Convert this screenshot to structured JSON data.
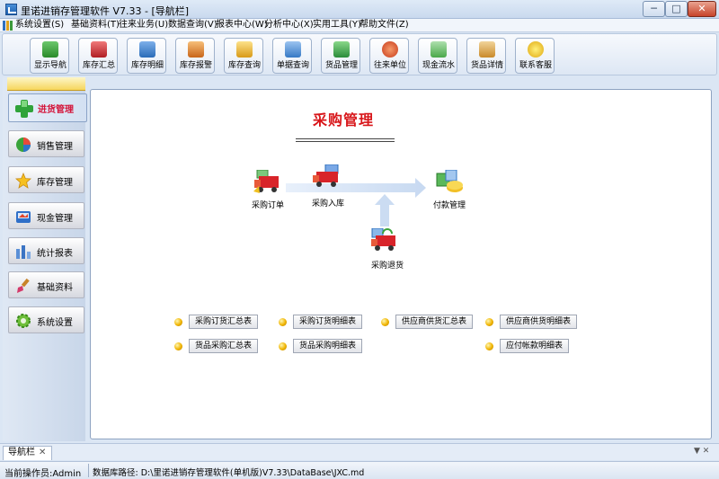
{
  "window": {
    "title": "里诺进销存管理软件 V7.33 - [导航栏]",
    "minimize_label": "─",
    "maximize_label": "□",
    "close_label": "✕"
  },
  "menu": {
    "items": [
      "系统设置(S)",
      "基础资料(T)",
      "往来业务(U)",
      "数据查询(V)",
      "报表中心(W)",
      "分析中心(X)",
      "实用工具(Y)",
      "帮助文件(Z)"
    ]
  },
  "toolbar": {
    "buttons": [
      {
        "label": "显示导航",
        "icon": "navigation-icon",
        "color": "#3a9a3a"
      },
      {
        "label": "库存汇总",
        "icon": "inventory-summary-icon",
        "color": "#c2272d"
      },
      {
        "label": "库存明细",
        "icon": "inventory-detail-icon",
        "color": "#2b6cb8"
      },
      {
        "label": "库存报警",
        "icon": "inventory-alarm-icon",
        "color": "#d07a1e"
      },
      {
        "label": "库存查询",
        "icon": "inventory-query-icon",
        "color": "#e0a020"
      },
      {
        "label": "单据查询",
        "icon": "document-query-icon",
        "color": "#3679c5"
      },
      {
        "label": "货品管理",
        "icon": "goods-management-icon",
        "color": "#2a8c3a"
      },
      {
        "label": "往来单位",
        "icon": "partners-icon",
        "color": "#d94a2a"
      },
      {
        "label": "现金流水",
        "icon": "cash-flow-icon",
        "color": "#4aa84a"
      },
      {
        "label": "货品详情",
        "icon": "goods-detail-icon",
        "color": "#c98a2a"
      },
      {
        "label": "联系客服",
        "icon": "customer-service-icon",
        "color": "#e8b820"
      }
    ]
  },
  "nav": {
    "items": [
      {
        "label": "进货管理",
        "icon": "plus-icon",
        "active": true
      },
      {
        "label": "销售管理",
        "icon": "pie-chart-icon"
      },
      {
        "label": "库存管理",
        "icon": "star-icon"
      },
      {
        "label": "现金管理",
        "icon": "cash-register-icon"
      },
      {
        "label": "统计报表",
        "icon": "bar-chart-icon"
      },
      {
        "label": "基础资料",
        "icon": "brush-icon"
      },
      {
        "label": "系统设置",
        "icon": "gear-icon"
      }
    ]
  },
  "main": {
    "title": "采购管理",
    "flow": {
      "order": "采购订单",
      "inbound": "采购入库",
      "payment": "付款管理",
      "return": "采购退货"
    },
    "report_links": [
      "采购订货汇总表",
      "采购订货明细表",
      "供应商供货汇总表",
      "供应商供货明细表",
      "货品采购汇总表",
      "货品采购明细表",
      "应付帐款明细表"
    ]
  },
  "tabs": {
    "items": [
      {
        "label": "导航栏",
        "close": "✕"
      }
    ],
    "overflow": "▼ ✕"
  },
  "status": {
    "operator": "当前操作员:Admin",
    "db_path": "数据库路径: D:\\里诺进销存管理软件(单机版)V7.33\\DataBase\\JXC.md"
  },
  "colors": {
    "accent_red": "#d8161a",
    "panel_blue": "#dbe6f4",
    "bullet_gold": "#f0b400"
  }
}
